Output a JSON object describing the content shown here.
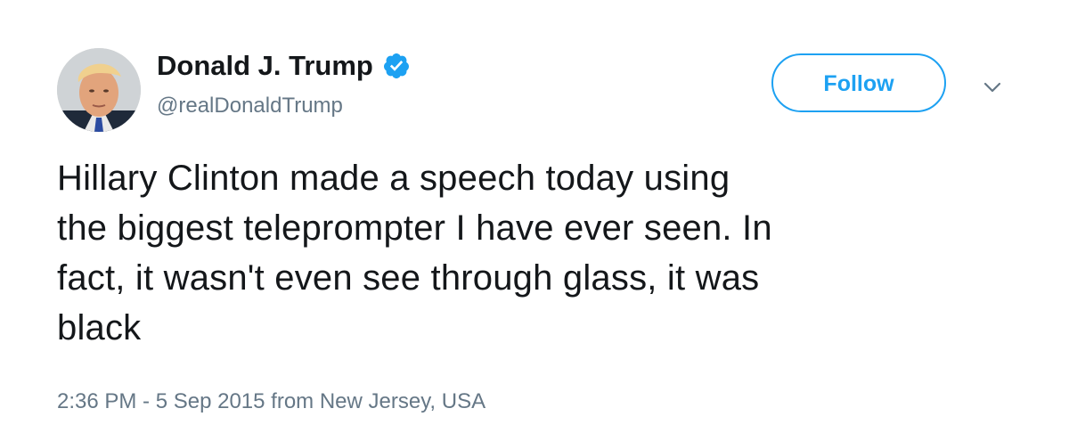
{
  "author": {
    "display_name": "Donald J. Trump",
    "handle": "@realDonaldTrump",
    "verified": true,
    "avatar_icon": "profile-photo"
  },
  "actions": {
    "follow_label": "Follow",
    "menu_icon": "chevron-down-icon"
  },
  "tweet": {
    "text_lines": [
      "Hillary Clinton made a speech today using",
      "the biggest teleprompter I have ever seen. In",
      "fact, it wasn't even see through glass, it was",
      "black"
    ],
    "timestamp": "2:36 PM - 5 Sep 2015 from New Jersey, USA"
  },
  "colors": {
    "accent": "#1da1f2",
    "text_primary": "#14171a",
    "text_secondary": "#657786"
  }
}
